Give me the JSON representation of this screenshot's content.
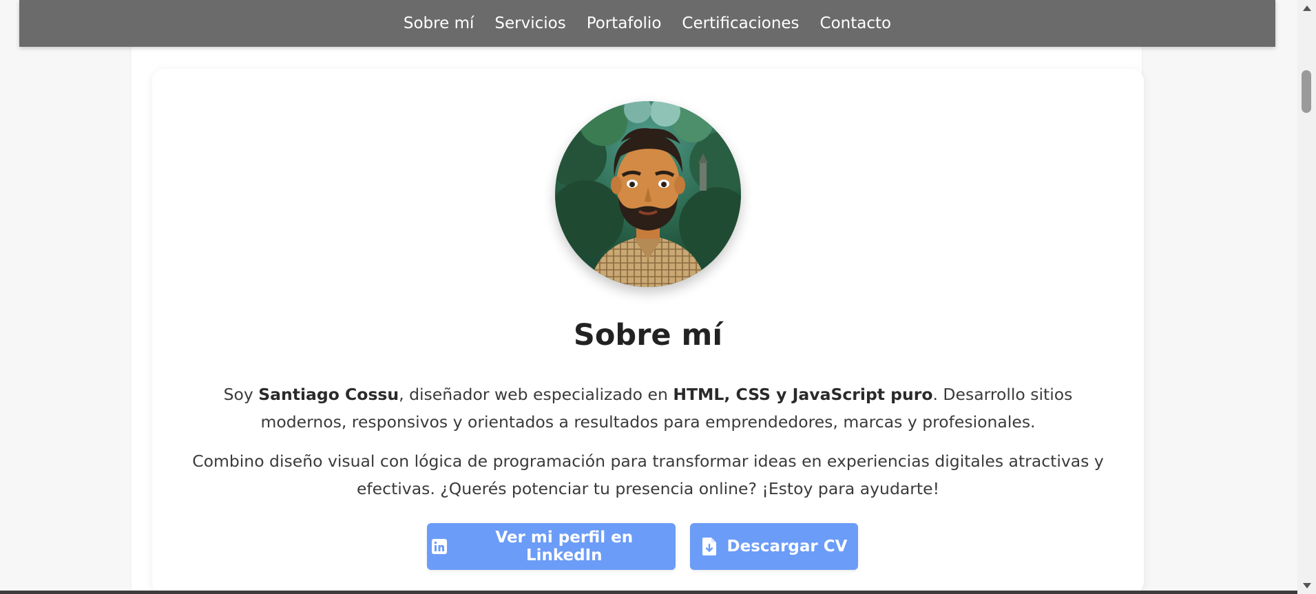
{
  "nav": {
    "items": [
      {
        "label": "Sobre mí"
      },
      {
        "label": "Servicios"
      },
      {
        "label": "Portafolio"
      },
      {
        "label": "Certificaciones"
      },
      {
        "label": "Contacto"
      }
    ]
  },
  "about": {
    "title": "Sobre mí",
    "p1": {
      "t1": "Soy ",
      "name": "Santiago Cossu",
      "t2": ", diseñador web especializado en ",
      "tech": "HTML, CSS y JavaScript puro",
      "t3": ". Desarrollo sitios modernos, responsivos y orientados a resultados para emprendedores, marcas y profesionales."
    },
    "p2": "Combino diseño visual con lógica de programación para transformar ideas en experiencias digitales atractivas y efectivas. ¿Querés potenciar tu presencia online? ¡Estoy para ayudarte!",
    "buttons": {
      "linkedin_label": "Ver mi perfil en LinkedIn",
      "linkedin_icon": "linkedin-icon",
      "cv_label": "Descargar CV",
      "cv_icon": "file-download-icon"
    }
  },
  "colors": {
    "navbar": "#6b6b6b",
    "button": "#6b9cf7",
    "title": "#222222",
    "text": "#3a3a3a"
  }
}
